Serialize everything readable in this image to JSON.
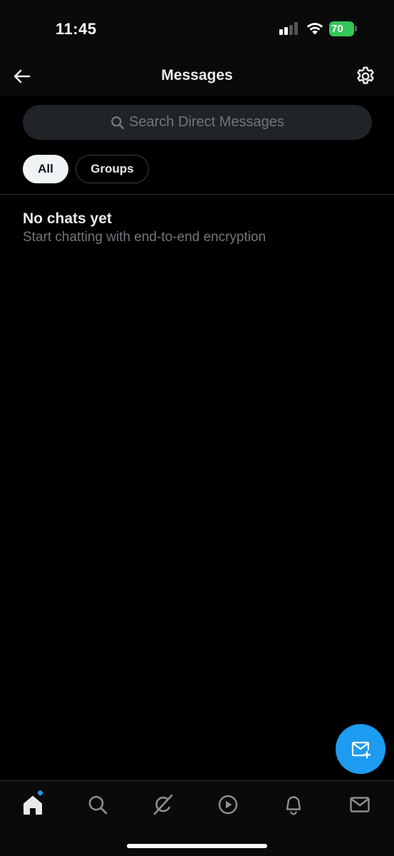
{
  "status_bar": {
    "time": "11:45",
    "battery_level": "70"
  },
  "header": {
    "title": "Messages",
    "back_icon": "arrow-left-icon",
    "settings_icon": "gear-icon"
  },
  "search": {
    "placeholder": "Search Direct Messages"
  },
  "filters": [
    {
      "label": "All",
      "selected": true
    },
    {
      "label": "Groups",
      "selected": false
    }
  ],
  "empty_state": {
    "title": "No chats yet",
    "subtitle": "Start chatting with end-to-end encryption"
  },
  "fab": {
    "icon": "new-message-icon"
  },
  "bottom_nav": {
    "items": [
      {
        "icon": "home-icon",
        "active": true,
        "has_notification_dot": true
      },
      {
        "icon": "search-icon",
        "active": false
      },
      {
        "icon": "grok-icon",
        "active": false
      },
      {
        "icon": "play-icon",
        "active": false
      },
      {
        "icon": "bell-icon",
        "active": false
      },
      {
        "icon": "mail-icon",
        "active": false
      }
    ]
  },
  "colors": {
    "background": "#000000",
    "accent": "#1d9bf0",
    "chip_selected_bg": "#eff3f4",
    "search_bg": "#202327",
    "muted_text": "#71767b",
    "battery": "#34c759"
  }
}
